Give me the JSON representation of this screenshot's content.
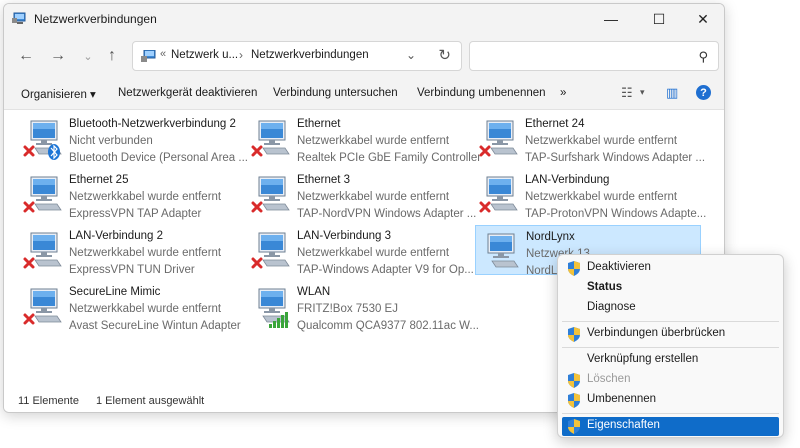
{
  "window": {
    "title": "Netzwerkverbindungen"
  },
  "window_controls": {
    "minimize": "—",
    "maximize": "☐",
    "close": "✕"
  },
  "nav": {
    "back": "←",
    "forward": "→",
    "up": "↑",
    "chevrons": "«"
  },
  "address": {
    "segment1": "Netzwerk u...",
    "separator": "›",
    "segment2": "Netzwerkverbindungen",
    "dropdown": "⌄",
    "refresh": "↻"
  },
  "search": {
    "placeholder": "",
    "icon": "⚲"
  },
  "toolbar": {
    "organize": "Organisieren ▾",
    "disable": "Netzwerkgerät deaktivieren",
    "diagnose": "Verbindung untersuchen",
    "rename": "Verbindung umbenennen",
    "more": "»",
    "view_icon": "☷",
    "view_dropdown": "▾",
    "pane_icon": "▥",
    "help": "?"
  },
  "items": [
    {
      "name": "Bluetooth-Netzwerkverbindung 2",
      "status": "Nicht verbunden",
      "device": "Bluetooth Device (Personal Area ...",
      "icon": "bluetooth-adapter-icon"
    },
    {
      "name": "Ethernet",
      "status": "Netzwerkkabel wurde entfernt",
      "device": "Realtek PCIe GbE Family Controller",
      "icon": "ethernet-disconnected-icon"
    },
    {
      "name": "Ethernet 24",
      "status": "Netzwerkkabel wurde entfernt",
      "device": "TAP-Surfshark Windows Adapter ...",
      "icon": "ethernet-disconnected-icon"
    },
    {
      "name": "Ethernet 25",
      "status": "Netzwerkkabel wurde entfernt",
      "device": "ExpressVPN TAP Adapter",
      "icon": "ethernet-disconnected-icon"
    },
    {
      "name": "Ethernet 3",
      "status": "Netzwerkkabel wurde entfernt",
      "device": "TAP-NordVPN Windows Adapter ...",
      "icon": "ethernet-disconnected-icon"
    },
    {
      "name": "LAN-Verbindung",
      "status": "Netzwerkkabel wurde entfernt",
      "device": "TAP-ProtonVPN Windows Adapte...",
      "icon": "ethernet-disconnected-icon"
    },
    {
      "name": "LAN-Verbindung 2",
      "status": "Netzwerkkabel wurde entfernt",
      "device": "ExpressVPN TUN Driver",
      "icon": "ethernet-disconnected-icon"
    },
    {
      "name": "LAN-Verbindung 3",
      "status": "Netzwerkkabel wurde entfernt",
      "device": "TAP-Windows Adapter V9 for Op...",
      "icon": "ethernet-disconnected-icon"
    },
    {
      "name": "NordLynx",
      "status": "Netzwerk 13",
      "device": "NordLy",
      "icon": "network-adapter-icon"
    },
    {
      "name": "SecureLine Mimic",
      "status": "Netzwerkkabel wurde entfernt",
      "device": "Avast SecureLine Wintun Adapter",
      "icon": "ethernet-disconnected-icon"
    },
    {
      "name": "WLAN",
      "status": "FRITZ!Box 7530 EJ",
      "device": "Qualcomm QCA9377 802.11ac W...",
      "icon": "wlan-signal-icon"
    }
  ],
  "statusbar": {
    "count": "11 Elemente",
    "selected": "1 Element ausgewählt"
  },
  "context_menu": [
    {
      "label": "Deaktivieren",
      "shield": true,
      "bold": false,
      "disabled": false
    },
    {
      "label": "Status",
      "shield": false,
      "bold": true,
      "disabled": false
    },
    {
      "label": "Diagnose",
      "shield": false,
      "bold": false,
      "disabled": false
    },
    {
      "label": "Verbindungen überbrücken",
      "shield": true,
      "bold": false,
      "disabled": false
    },
    {
      "label": "Verknüpfung erstellen",
      "shield": false,
      "bold": false,
      "disabled": false
    },
    {
      "label": "Löschen",
      "shield": true,
      "bold": false,
      "disabled": true
    },
    {
      "label": "Umbenennen",
      "shield": true,
      "bold": false,
      "disabled": false
    },
    {
      "label": "Eigenschaften",
      "shield": true,
      "bold": false,
      "disabled": false,
      "highlighted": true
    }
  ],
  "colors": {
    "accent": "#0f6cc9",
    "selection_bg": "#cce8ff",
    "error_red": "#d92b2b",
    "signal_green": "#3aa53a",
    "bluetooth_blue": "#1e76d6"
  }
}
